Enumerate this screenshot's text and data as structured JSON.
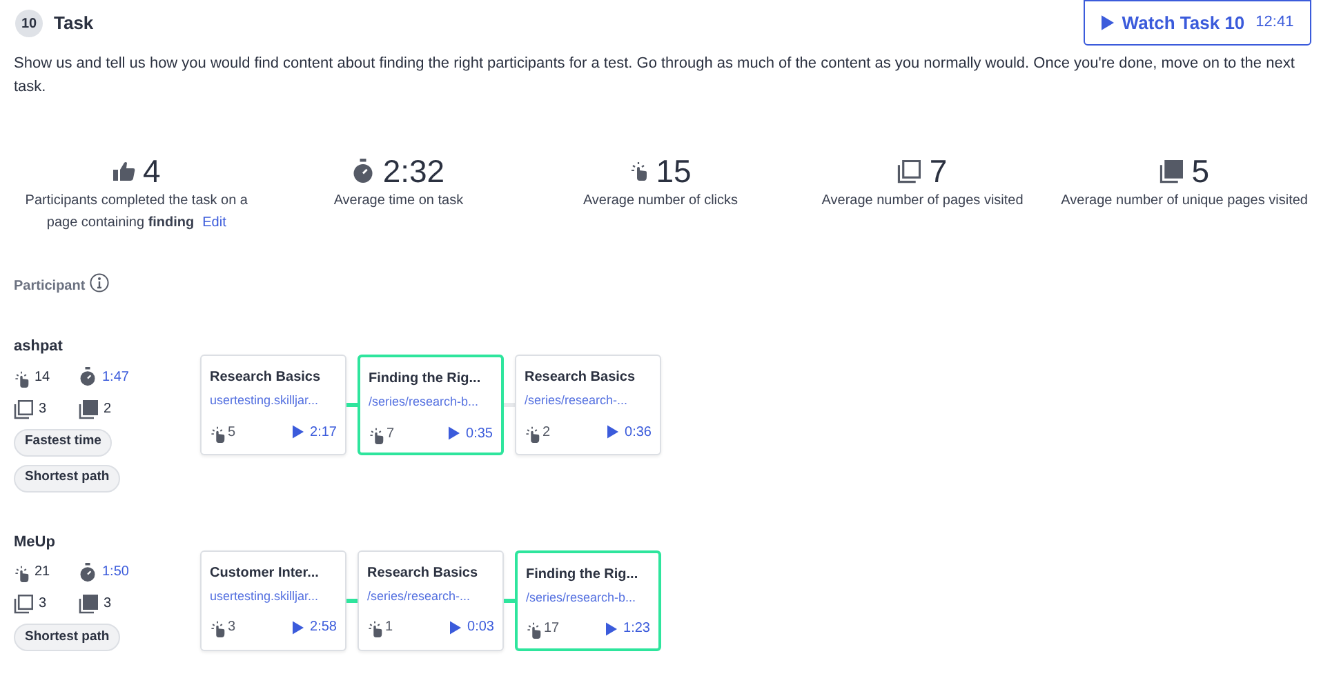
{
  "task": {
    "number": "10",
    "title": "Task",
    "watch_button": {
      "label": "Watch Task 10",
      "duration": "12:41"
    },
    "description": "Show us and tell us how you would find content about finding the right participants for a test. Go through as much of the content as you normally would. Once you're done, move on to the next task."
  },
  "stats": [
    {
      "kind": "completed",
      "value": "4",
      "label": "Participants completed the task on a page containing **finding**",
      "link": "Edit"
    },
    {
      "kind": "time",
      "value": "2:32",
      "label": "Average time on task"
    },
    {
      "kind": "clicks",
      "value": "15",
      "label": "Average number of clicks"
    },
    {
      "kind": "pages",
      "value": "7",
      "label": "Average number of pages visited"
    },
    {
      "kind": "unique",
      "value": "5",
      "label": "Average number of unique pages visited"
    }
  ],
  "participant_heading": "Participant",
  "participants": [
    {
      "name": "ashpat",
      "clicks": "14",
      "time": "1:47",
      "pages": "3",
      "unique_pages": "2",
      "tags": [
        "Fastest time",
        "Shortest path"
      ],
      "path": [
        {
          "title": "Research Basics",
          "url": "usertesting.skilljar...",
          "clicks": "5",
          "time": "2:17",
          "highlighted": false
        },
        {
          "title": "Finding the Rig...",
          "url": "/series/research-b...",
          "clicks": "7",
          "time": "0:35",
          "highlighted": true,
          "link_highlighted": true
        },
        {
          "title": "Research Basics",
          "url": "/series/research-...",
          "clicks": "2",
          "time": "0:36",
          "highlighted": false,
          "link_highlighted": false
        }
      ]
    },
    {
      "name": "MeUp",
      "clicks": "21",
      "time": "1:50",
      "pages": "3",
      "unique_pages": "3",
      "tags": [
        "Shortest path"
      ],
      "path": [
        {
          "title": "Customer Inter...",
          "url": "usertesting.skilljar...",
          "clicks": "3",
          "time": "2:58",
          "highlighted": false
        },
        {
          "title": "Research Basics",
          "url": "/series/research-...",
          "clicks": "1",
          "time": "0:03",
          "highlighted": false,
          "link_highlighted": true
        },
        {
          "title": "Finding the Rig...",
          "url": "/series/research-b...",
          "clicks": "17",
          "time": "1:23",
          "highlighted": true,
          "link_highlighted": true
        }
      ]
    }
  ]
}
